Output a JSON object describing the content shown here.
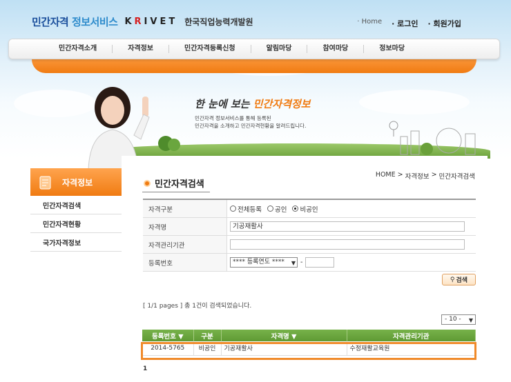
{
  "header": {
    "logo_main": "민간자격",
    "logo_sub": "정보서비스",
    "logo_krivet_pre": "K",
    "logo_krivet_r": "R",
    "logo_krivet_post": "IVET",
    "logo_org": "한국직업능력개발원",
    "links": {
      "home": "· Home",
      "login": "· 로그인",
      "join": "· 회원가입"
    }
  },
  "nav": {
    "items": [
      "민간자격소개",
      "자격정보",
      "민간자격등록신청",
      "알림마당",
      "참여마당",
      "정보마당"
    ]
  },
  "banner": {
    "title_pre": "한 눈에 보는 ",
    "title_hl": "민간자격정보",
    "desc_line1": "민간자격 정보서비스를 통해 등록된",
    "desc_line2": "민간자격을 소개하고 민간자격현황을 알려드립니다."
  },
  "sidebar": {
    "title": "자격정보",
    "items": [
      "민간자격검색",
      "민간자격현황",
      "국가자격정보"
    ]
  },
  "main": {
    "title": "민간자격검색",
    "breadcrumb": [
      "HOME",
      ">",
      "자격정보",
      ">",
      "민간자격검색"
    ],
    "form": {
      "type_label": "자격구분",
      "type_options": [
        "전체등록",
        "공인",
        "비공인"
      ],
      "type_selected": "비공인",
      "name_label": "자격명",
      "name_value": "기공재활사",
      "org_label": "자격관리기관",
      "org_value": "",
      "regno_label": "등록번호",
      "regno_select": "**** 등록연도 ****",
      "regno_dash": "-"
    },
    "search_button": "검색",
    "result_count": "[ 1/1 pages ] 총 1건이 검색되었습니다.",
    "per_page": "- 10 -",
    "table": {
      "headers": [
        "등록번호 ▼",
        "구분",
        "자격명 ▼",
        "자격관리기관"
      ],
      "rows": [
        [
          "2014-5765",
          "비공인",
          "기공재활사",
          "수정재활교육원"
        ]
      ]
    },
    "pager": "1"
  },
  "colors": {
    "accent_orange": "#f07b12",
    "table_green": "#6aa63e",
    "brand_blue": "#1b4f9c"
  }
}
